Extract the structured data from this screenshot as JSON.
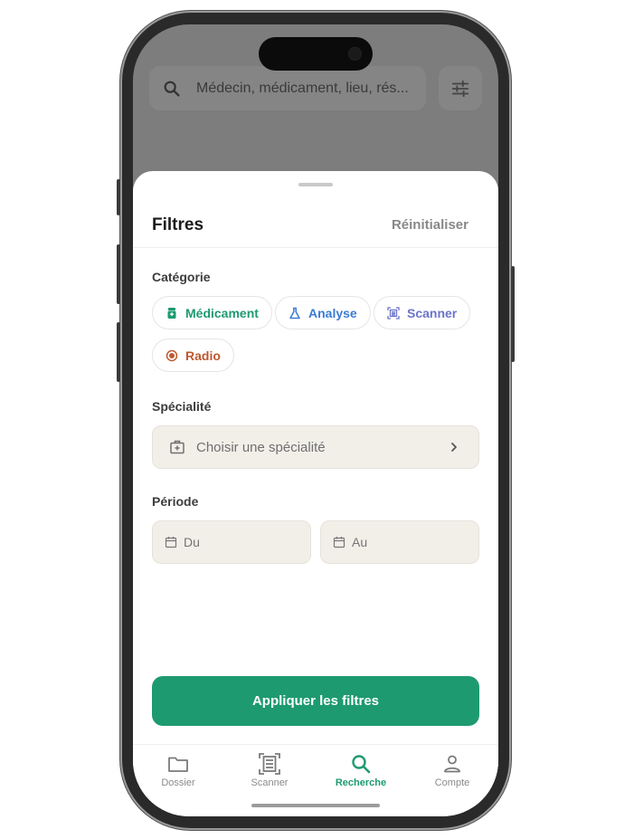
{
  "search": {
    "placeholder": "Médecin, médicament, lieu, rés...",
    "icon": "search-icon"
  },
  "filter_button": {
    "icon": "sliders-icon"
  },
  "sheet": {
    "title": "Filtres",
    "reset_label": "Réinitialiser",
    "category": {
      "label": "Catégorie",
      "chips": [
        {
          "label": "Médicament",
          "icon": "pill-bottle-icon",
          "color": "#1e9a70"
        },
        {
          "label": "Analyse",
          "icon": "flask-icon",
          "color": "#3a7bd5"
        },
        {
          "label": "Scanner",
          "icon": "scan-icon",
          "color": "#6b74c9"
        },
        {
          "label": "Radio",
          "icon": "radio-target-icon",
          "color": "#c0572f"
        }
      ]
    },
    "specialty": {
      "label": "Spécialité",
      "placeholder": "Choisir une spécialité"
    },
    "period": {
      "label": "Période",
      "from": "Du",
      "to": "Au"
    },
    "apply_label": "Appliquer les filtres"
  },
  "tabs": [
    {
      "label": "Dossier",
      "icon": "folder-icon",
      "active": false
    },
    {
      "label": "Scanner",
      "icon": "document-scan-icon",
      "active": false
    },
    {
      "label": "Recherche",
      "icon": "search-icon",
      "active": true
    },
    {
      "label": "Compte",
      "icon": "user-icon",
      "active": false
    }
  ],
  "colors": {
    "accent": "#1e9a70",
    "overlay": "#7d7d7d",
    "input_bg": "#f2efe9"
  }
}
